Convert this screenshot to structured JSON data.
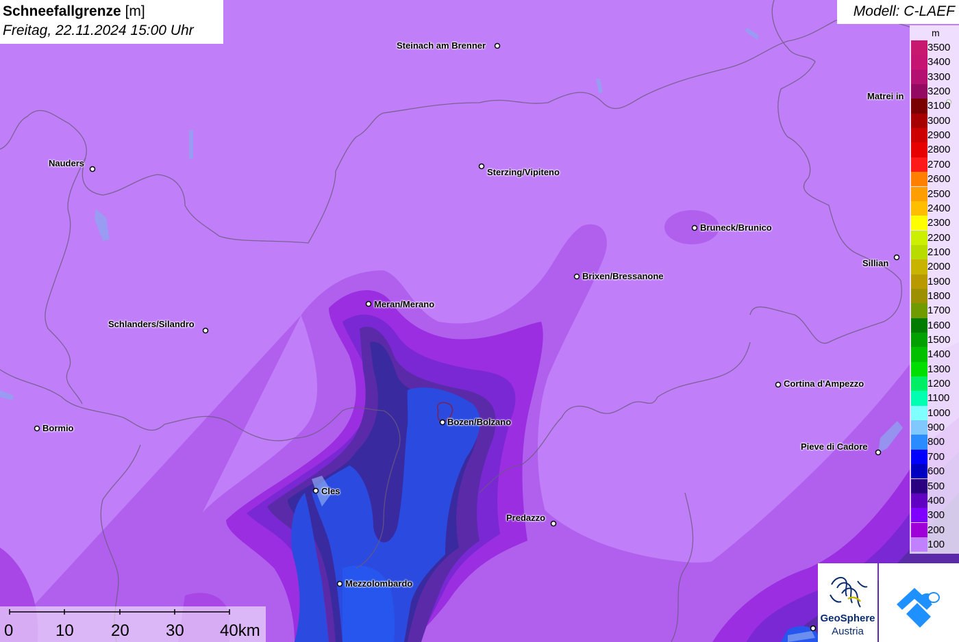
{
  "header": {
    "title": "Schneefallgrenze",
    "unit": "[m]",
    "datetime": "Freitag, 22.11.2024 15:00 Uhr"
  },
  "model": {
    "label": "Modell: C-LAEF"
  },
  "legend": {
    "unit": "m",
    "entries": [
      {
        "value": "3500",
        "color": "#c8176e"
      },
      {
        "value": "3400",
        "color": "#c51472"
      },
      {
        "value": "3300",
        "color": "#b41072"
      },
      {
        "value": "3200",
        "color": "#940a63"
      },
      {
        "value": "3100",
        "color": "#7a0000"
      },
      {
        "value": "3000",
        "color": "#a70000"
      },
      {
        "value": "2900",
        "color": "#cc0000"
      },
      {
        "value": "2800",
        "color": "#e60000"
      },
      {
        "value": "2700",
        "color": "#ff1a1a"
      },
      {
        "value": "2600",
        "color": "#ff7f00"
      },
      {
        "value": "2500",
        "color": "#ff9e00"
      },
      {
        "value": "2400",
        "color": "#ffbf00"
      },
      {
        "value": "2300",
        "color": "#ffff00"
      },
      {
        "value": "2200",
        "color": "#ccee00"
      },
      {
        "value": "2100",
        "color": "#b8dc00"
      },
      {
        "value": "2000",
        "color": "#c8b400"
      },
      {
        "value": "1900",
        "color": "#b89a00"
      },
      {
        "value": "1800",
        "color": "#9c9000"
      },
      {
        "value": "1700",
        "color": "#6f9b00"
      },
      {
        "value": "1600",
        "color": "#007d00"
      },
      {
        "value": "1500",
        "color": "#00a000"
      },
      {
        "value": "1400",
        "color": "#00c000"
      },
      {
        "value": "1300",
        "color": "#00dd00"
      },
      {
        "value": "1200",
        "color": "#00ee66"
      },
      {
        "value": "1100",
        "color": "#00ffb0"
      },
      {
        "value": "1000",
        "color": "#80ffff"
      },
      {
        "value": "900",
        "color": "#80c8ff"
      },
      {
        "value": "800",
        "color": "#2a8cff"
      },
      {
        "value": "700",
        "color": "#0000ff"
      },
      {
        "value": "600",
        "color": "#0000c0"
      },
      {
        "value": "500",
        "color": "#2a0080"
      },
      {
        "value": "400",
        "color": "#6000c0"
      },
      {
        "value": "300",
        "color": "#8000ff"
      },
      {
        "value": "200",
        "color": "#a000d8"
      },
      {
        "value": "100",
        "color": "#c080ff"
      }
    ]
  },
  "places": {
    "steinach": "Steinach am Brenner",
    "matrei": "Matrei in",
    "nauders": "Nauders",
    "sterzing": "Sterzing/Vipiteno",
    "bruneck": "Bruneck/Brunico",
    "sillian": "Sillian",
    "brixen": "Brixen/Bressanone",
    "meran": "Meran/Merano",
    "schlanders": "Schlanders/Silandro",
    "cortina": "Cortina d'Ampezzo",
    "bormio": "Bormio",
    "bozen": "Bozen/Bolzano",
    "pieve": "Pieve di Cadore",
    "cles": "Cles",
    "predazzo": "Predazzo",
    "mezzolombardo": "Mezzolombardo"
  },
  "scale": {
    "labels": [
      "0",
      "10",
      "20",
      "30",
      "40km"
    ]
  },
  "logos": {
    "geosphere_line1": "GeoSphere",
    "geosphere_line2": "Austria"
  }
}
